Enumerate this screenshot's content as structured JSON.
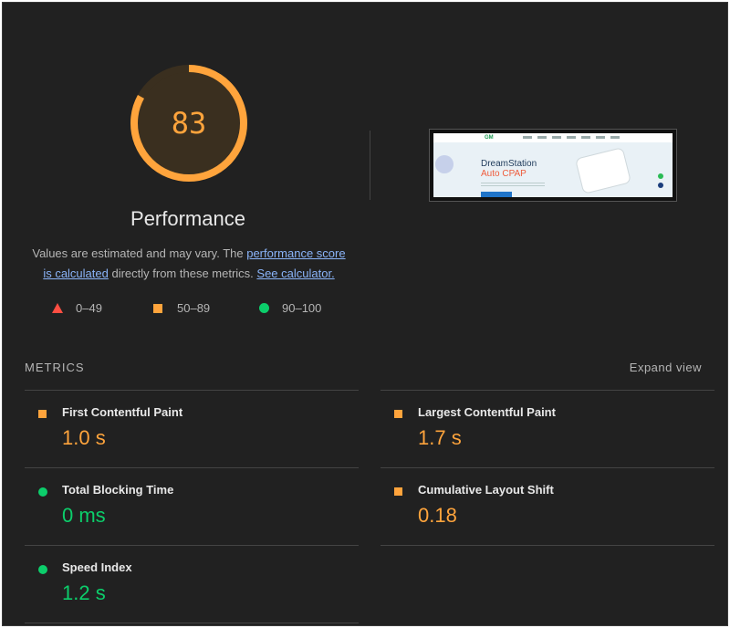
{
  "gauge": {
    "score": "83",
    "fraction": 0.83,
    "title": "Performance"
  },
  "description": {
    "text1": "Values are estimated and may vary. The ",
    "link1": "performance score is calculated",
    "text2": " directly from these metrics. ",
    "link2": "See calculator."
  },
  "legend": [
    {
      "label": "0–49"
    },
    {
      "label": "50–89"
    },
    {
      "label": "90–100"
    }
  ],
  "thumbnail": {
    "headline1": "DreamStation",
    "headline2": "Auto CPAP",
    "logo": "GM"
  },
  "metrics": {
    "title": "METRICS",
    "expand_label": "Expand view",
    "items": [
      {
        "name": "First Contentful Paint",
        "value": "1.0 s",
        "rating": "average",
        "icon": "orange-square-icon"
      },
      {
        "name": "Largest Contentful Paint",
        "value": "1.7 s",
        "rating": "average",
        "icon": "orange-square-icon"
      },
      {
        "name": "Total Blocking Time",
        "value": "0 ms",
        "rating": "pass",
        "icon": "green-circle-icon"
      },
      {
        "name": "Cumulative Layout Shift",
        "value": "0.18",
        "rating": "average",
        "icon": "orange-square-icon"
      },
      {
        "name": "Speed Index",
        "value": "1.2 s",
        "rating": "pass",
        "icon": "green-circle-icon"
      }
    ]
  },
  "colors": {
    "fail": "#ff4e42",
    "average": "#ffa43c",
    "pass": "#0cce6b",
    "background": "#212121"
  }
}
